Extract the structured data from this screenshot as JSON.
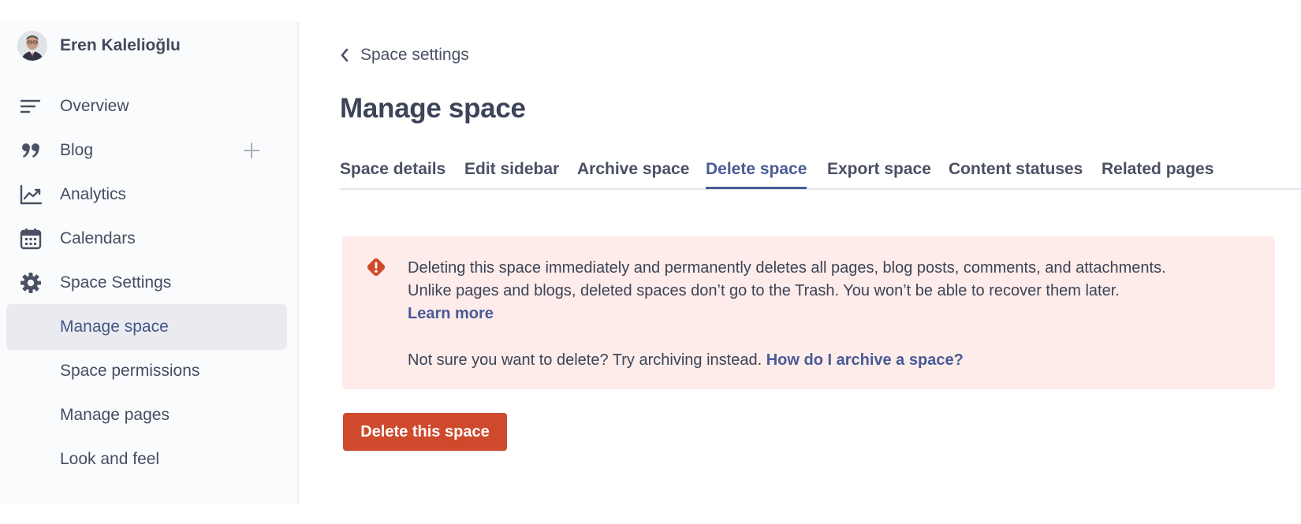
{
  "sidebar": {
    "user_name": "Eren Kalelioğlu",
    "items": [
      {
        "label": "Overview",
        "icon": "overview-icon"
      },
      {
        "label": "Blog",
        "icon": "quote-icon"
      },
      {
        "label": "Analytics",
        "icon": "analytics-icon"
      },
      {
        "label": "Calendars",
        "icon": "calendar-icon"
      },
      {
        "label": "Space Settings",
        "icon": "gear-icon"
      },
      {
        "label": "Manage space",
        "active": true
      },
      {
        "label": "Space permissions"
      },
      {
        "label": "Manage pages"
      },
      {
        "label": "Look and feel"
      }
    ]
  },
  "header": {
    "back_label": "Space settings",
    "title": "Manage space"
  },
  "tabs": [
    {
      "label": "Space details"
    },
    {
      "label": "Edit sidebar"
    },
    {
      "label": "Archive space"
    },
    {
      "label": "Delete space",
      "active": true
    },
    {
      "label": "Export space"
    },
    {
      "label": "Content statuses"
    },
    {
      "label": "Related pages"
    }
  ],
  "notice": {
    "line1": "Deleting this space immediately and permanently deletes all pages, blog posts, comments, and attachments.",
    "line2": "Unlike pages and blogs, deleted spaces don’t go to the Trash. You won’t be able to recover them later.",
    "learn_more": "Learn more",
    "line3": "Not sure you want to delete? Try archiving instead.",
    "archive_link": "How do I archive a space?"
  },
  "delete_button": "Delete this space",
  "colors": {
    "accent": "#4b5b95",
    "danger": "#cf4a2c",
    "notice_bg": "#fdecea",
    "active_bg": "#e9ebf0"
  }
}
